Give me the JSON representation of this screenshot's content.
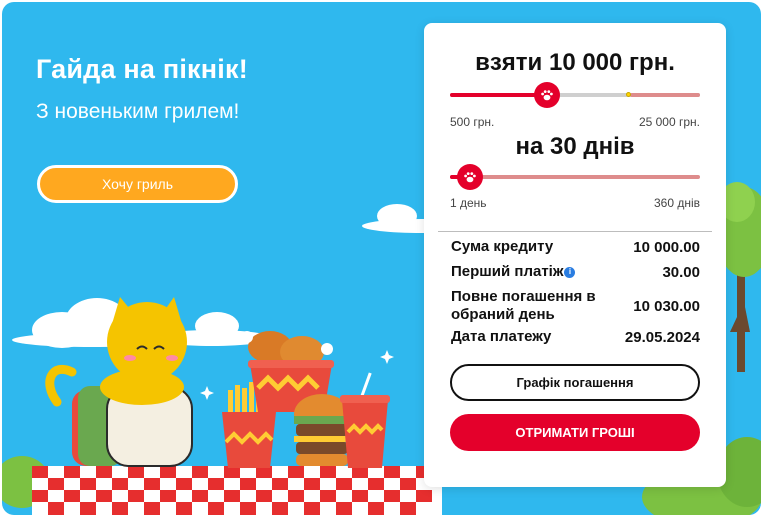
{
  "promo": {
    "title": "Гайда на пікнік!",
    "subtitle": "З новеньким грилем!",
    "button_label": "Хочу гриль"
  },
  "calculator": {
    "amount_heading": "взяти 10 000 грн.",
    "amount_slider": {
      "min_label": "500 грн.",
      "max_label": "25 000 грн.",
      "value": 10000,
      "min": 500,
      "max": 25000
    },
    "days_heading": "на 30 днів",
    "days_slider": {
      "min_label": "1 день",
      "max_label": "360 днів",
      "value": 30,
      "min": 1,
      "max": 360
    }
  },
  "summary": {
    "rows": [
      {
        "label": "Сума кредиту",
        "value": "10 000.00"
      },
      {
        "label": "Перший платіж",
        "value": "30.00"
      },
      {
        "label": "Повне погашення в обраний день",
        "value": "10 030.00"
      },
      {
        "label": "Дата платежу",
        "value": "29.05.2024"
      }
    ]
  },
  "buttons": {
    "schedule": "Графік погашення",
    "get_money": "ОТРИМАТИ ГРОШІ"
  },
  "colors": {
    "accent": "#e4002b",
    "banner_bg": "#2fb8ee",
    "promo_button": "#ffa81f"
  },
  "icons": {
    "slider_thumb": "paw-icon",
    "info": "info-icon"
  }
}
